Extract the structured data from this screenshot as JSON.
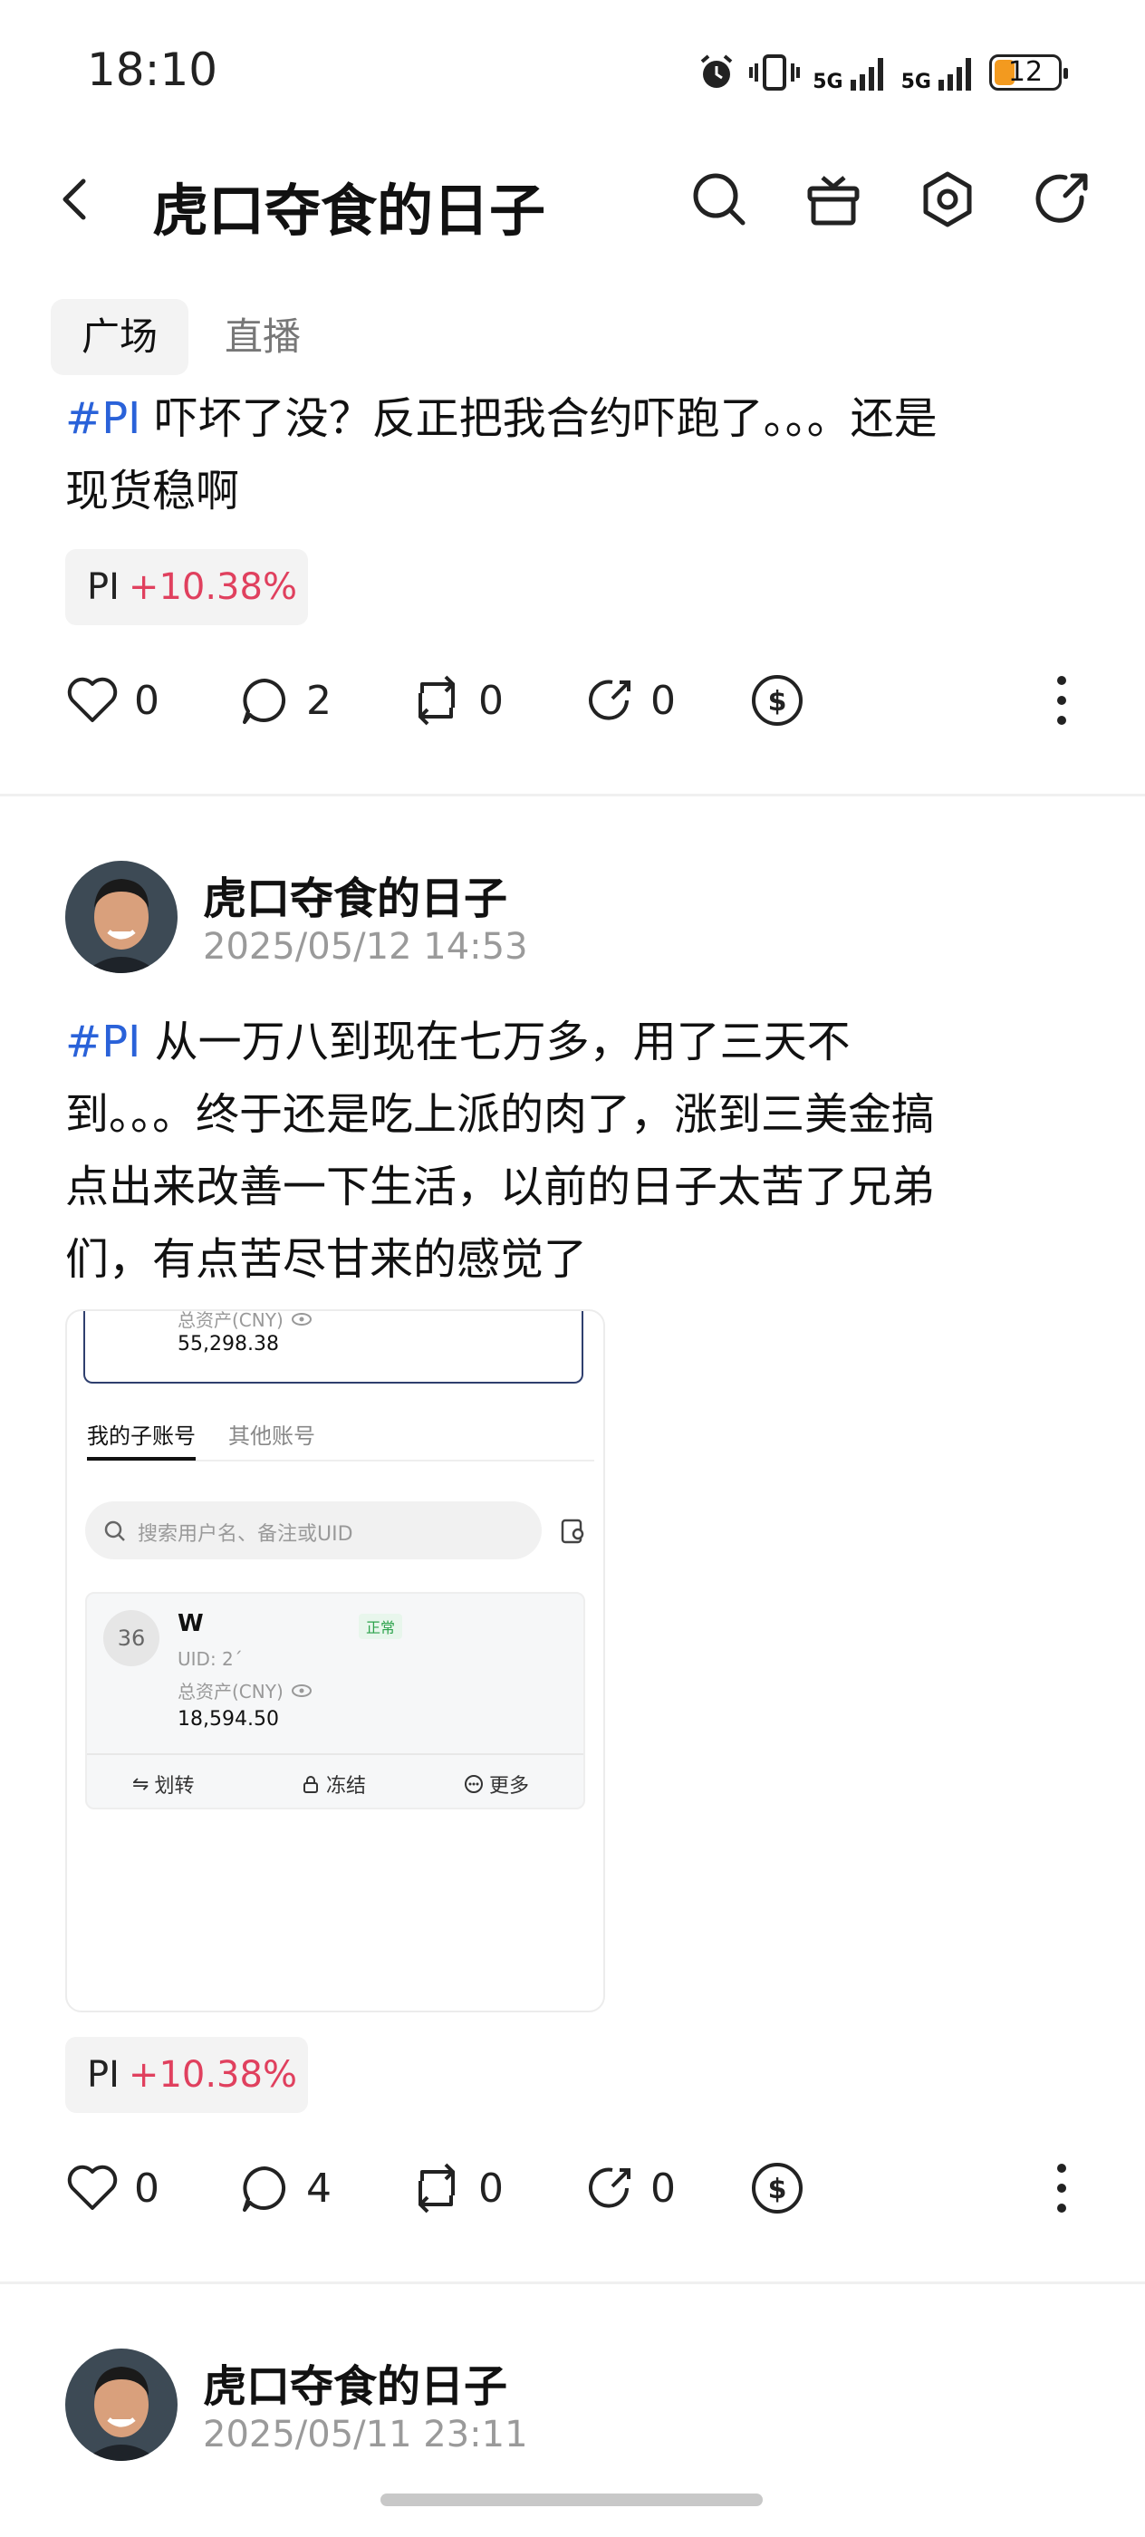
{
  "status_bar": {
    "time": "18:10",
    "net1": "5G",
    "net2": "5G",
    "battery": "12",
    "accent": "#f39a1f"
  },
  "header": {
    "title": "虎口夺食的日子",
    "icons": [
      "back-icon",
      "search-icon",
      "gift-icon",
      "hexagon-settings-icon",
      "share-icon"
    ]
  },
  "tabs": [
    {
      "label": "广场",
      "active": true
    },
    {
      "label": "直播",
      "active": false
    }
  ],
  "posts": [
    {
      "hashtag": "#PI",
      "text_line1": " 吓坏了没？反正把我合约吓跑了。。。还是",
      "text_line2": "现货稳啊",
      "tag": {
        "symbol": "PI",
        "change": "+10.38%"
      },
      "likes": "0",
      "comments": "2",
      "reposts": "0",
      "shares": "0"
    },
    {
      "author": "虎口夺食的日子",
      "date": "2025/05/12 14:53",
      "hashtag": "#PI",
      "text_line1": " 从一万八到现在七万多，用了三天不",
      "text_line2": "到。。。终于还是吃上派的肉了，涨到三美金搞",
      "text_line3": "点出来改善一下生活，以前的日子太苦了兄弟",
      "text_line4": "们，有点苦尽甘来的感觉了",
      "tag": {
        "symbol": "PI",
        "change": "+10.38%"
      },
      "likes": "0",
      "comments": "4",
      "reposts": "0",
      "shares": "0"
    },
    {
      "author": "虎口夺食的日子",
      "date": "2025/05/11 23:11"
    }
  ],
  "embedded_screenshot": {
    "total_label": "总资产(CNY)",
    "total_value": "55,298.38",
    "tab_my": "我的子账号",
    "tab_other": "其他账号",
    "search_placeholder": "搜索用户名、备注或UID",
    "account": {
      "avatar_text": "36",
      "name": "W",
      "status": "正常",
      "uid": "UID: 2´",
      "asset_label": "总资产(CNY)",
      "asset_value": "18,594.50"
    },
    "actions": [
      "划转",
      "冻结",
      "更多"
    ]
  }
}
